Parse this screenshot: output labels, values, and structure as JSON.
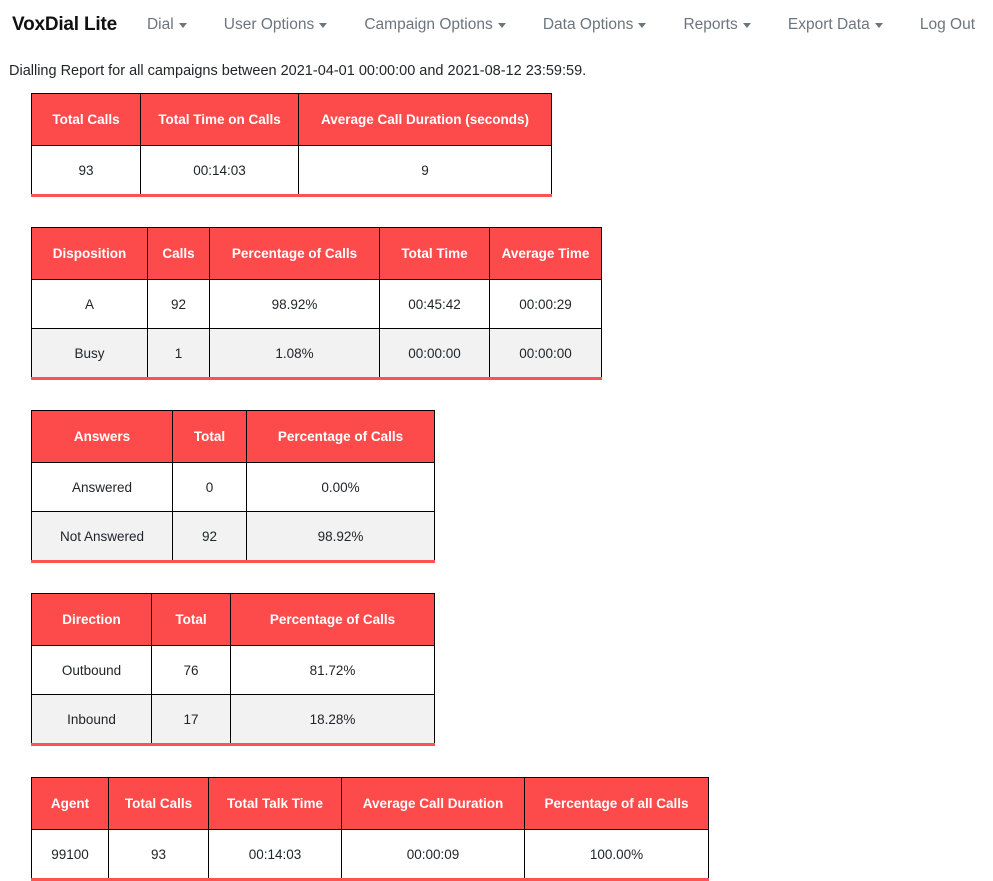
{
  "navbar": {
    "brand": "VoxDial Lite",
    "items": [
      {
        "label": "Dial",
        "has_caret": true
      },
      {
        "label": "User Options",
        "has_caret": true
      },
      {
        "label": "Campaign Options",
        "has_caret": true
      },
      {
        "label": "Data Options",
        "has_caret": true
      },
      {
        "label": "Reports",
        "has_caret": true
      },
      {
        "label": "Export Data",
        "has_caret": true
      },
      {
        "label": "Log Out",
        "has_caret": false
      }
    ]
  },
  "report": {
    "description": "Dialling Report for all campaigns between 2021-04-01 00:00:00 and 2021-08-12 23:59:59."
  },
  "colors": {
    "header_red": "#fd4b4b",
    "border_red": "#fc5252",
    "row_stripe": "#f2f2f2",
    "nav_link": "#6c757d",
    "cell_border": "#000000"
  },
  "tables": [
    {
      "id": "summary",
      "headers": [
        "Total Calls",
        "Total Time on Calls",
        "Average Call Duration (seconds)"
      ],
      "rows": [
        [
          "93",
          "00:14:03",
          "9"
        ]
      ]
    },
    {
      "id": "disposition",
      "headers": [
        "Disposition",
        "Calls",
        "Percentage of Calls",
        "Total Time",
        "Average Time"
      ],
      "rows": [
        [
          "A",
          "92",
          "98.92%",
          "00:45:42",
          "00:00:29"
        ],
        [
          "Busy",
          "1",
          "1.08%",
          "00:00:00",
          "00:00:00"
        ]
      ]
    },
    {
      "id": "answers",
      "headers": [
        "Answers",
        "Total",
        "Percentage of Calls"
      ],
      "rows": [
        [
          "Answered",
          "0",
          "0.00%"
        ],
        [
          "Not Answered",
          "92",
          "98.92%"
        ]
      ]
    },
    {
      "id": "direction",
      "headers": [
        "Direction",
        "Total",
        "Percentage of Calls"
      ],
      "rows": [
        [
          "Outbound",
          "76",
          "81.72%"
        ],
        [
          "Inbound",
          "17",
          "18.28%"
        ]
      ]
    },
    {
      "id": "agent",
      "headers": [
        "Agent",
        "Total Calls",
        "Total Talk Time",
        "Average Call Duration",
        "Percentage of all Calls"
      ],
      "rows": [
        [
          "99100",
          "93",
          "00:14:03",
          "00:00:09",
          "100.00%"
        ]
      ]
    }
  ]
}
